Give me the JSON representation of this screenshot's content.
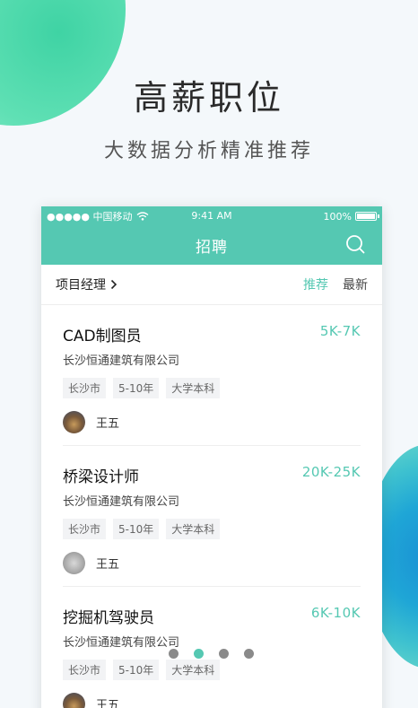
{
  "headline": "高薪职位",
  "subline": "大数据分析精准推荐",
  "status": {
    "carrier": "●●●●● 中国移动",
    "time": "9:41 AM",
    "battery": "100%"
  },
  "app": {
    "title": "招聘",
    "filter_label": "项目经理",
    "sort_recommend": "推荐",
    "sort_newest": "最新"
  },
  "jobs": [
    {
      "title": "CAD制图员",
      "salary": "5K-7K",
      "company": "长沙恒通建筑有限公司",
      "tags": [
        "长沙市",
        "5-10年",
        "大学本科"
      ],
      "contact": "王五"
    },
    {
      "title": "桥梁设计师",
      "salary": "20K-25K",
      "company": "长沙恒通建筑有限公司",
      "tags": [
        "长沙市",
        "5-10年",
        "大学本科"
      ],
      "contact": "王五"
    },
    {
      "title": "挖掘机驾驶员",
      "salary": "6K-10K",
      "company": "长沙恒通建筑有限公司",
      "tags": [
        "长沙市",
        "5-10年",
        "大学本科"
      ],
      "contact": "王五"
    }
  ],
  "pager": {
    "count": 4,
    "active_index": 1
  },
  "colors": {
    "accent": "#55c8b2",
    "blob_green": "#3fd3a4",
    "blob_blue": "#1a8fd4"
  }
}
